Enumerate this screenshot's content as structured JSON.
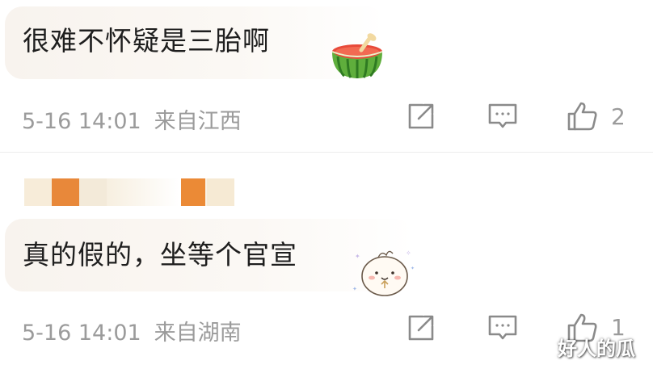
{
  "comments": [
    {
      "text": "很难不怀疑是三胎啊",
      "emoji": "watermelon-icon",
      "timestamp": "5-16 14:01",
      "region": "来自江西",
      "like_count": "2"
    },
    {
      "text": "真的假的，坐等个官宣",
      "emoji": "cute-blob-sticker-icon",
      "timestamp": "5-16 14:01",
      "region": "来自湖南",
      "like_count": "1"
    }
  ],
  "watermark": "好人的瓜",
  "colors": {
    "meta_gray": "#9b9b9b",
    "bubble": "#f8f3ee",
    "mask_orange": "#e8883a",
    "mask_beige": "#f5e9d6"
  }
}
